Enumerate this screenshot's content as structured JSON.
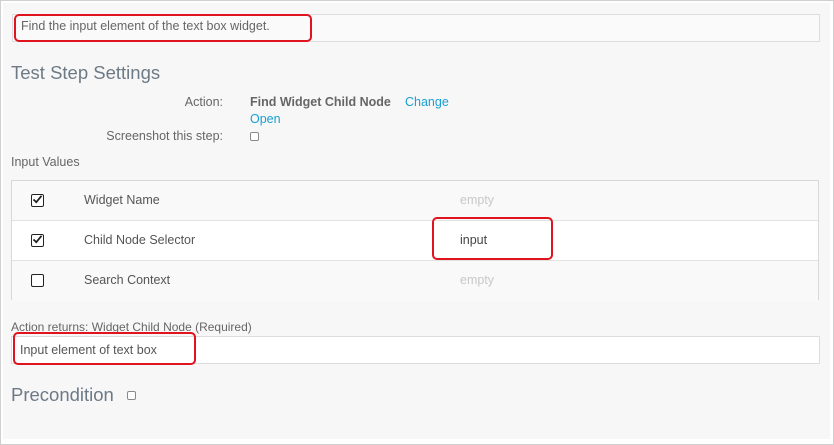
{
  "description": {
    "value": "Find the input element of the text box widget."
  },
  "settings": {
    "title": "Test Step Settings",
    "action_label": "Action:",
    "action_value": "Find Widget Child Node",
    "change_link": "Change",
    "open_link": "Open",
    "screenshot_label": "Screenshot this step:",
    "screenshot_checked": false
  },
  "input_values": {
    "label": "Input Values",
    "rows": [
      {
        "name": "Widget Name",
        "value": "empty",
        "checked": true
      },
      {
        "name": "Child Node Selector",
        "value": "input",
        "checked": true
      },
      {
        "name": "Search Context",
        "value": "empty",
        "checked": false
      }
    ]
  },
  "returns": {
    "label": "Action returns: Widget Child Node (Required)",
    "value": "Input element of text box"
  },
  "precondition": {
    "title": "Precondition",
    "checked": false
  },
  "colors": {
    "highlight": "#e0141e",
    "link": "#1a9fd4",
    "heading": "#6d7a86"
  }
}
